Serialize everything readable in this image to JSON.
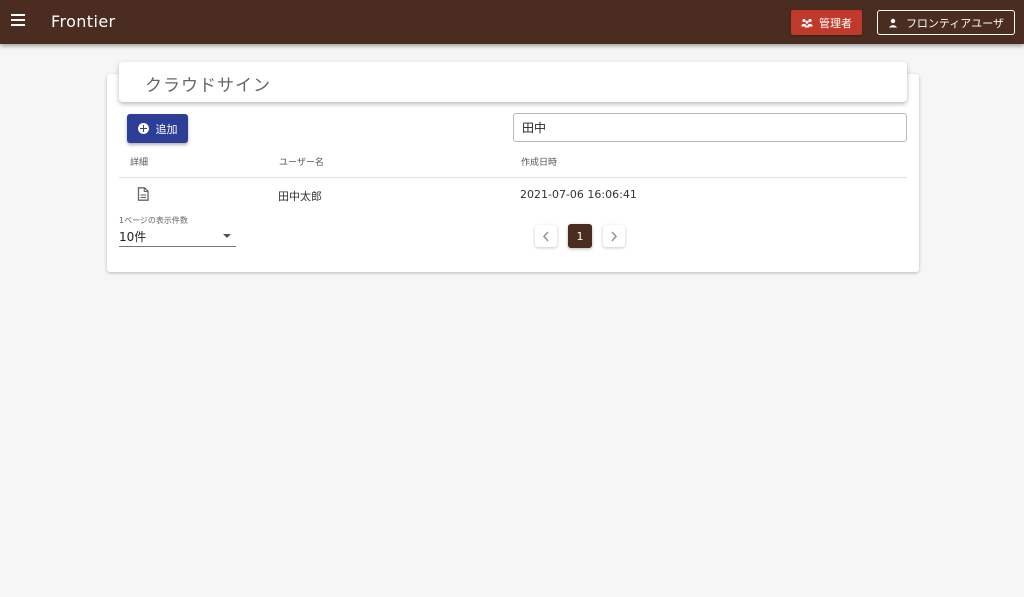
{
  "app": {
    "title": "Frontier"
  },
  "header": {
    "admin_label": "管理者",
    "user_label": "フロンティアユーザ"
  },
  "page": {
    "title": "クラウドサイン"
  },
  "toolbar": {
    "add_label": "追加"
  },
  "search": {
    "value": "田中"
  },
  "table": {
    "columns": [
      "詳細",
      "ユーザー名",
      "作成日時"
    ],
    "rows": [
      {
        "username": "田中太郎",
        "created_at": "2021-07-06 16:06:41"
      }
    ]
  },
  "pagination": {
    "per_page_label": "1ページの表示件数",
    "per_page_value": "10件",
    "current_page": "1"
  },
  "icons": {
    "menu": "menu-icon",
    "admin": "group-icon",
    "user": "person-icon",
    "add": "add-circle-icon",
    "detail": "document-icon",
    "prev": "chevron-left-icon",
    "next": "chevron-right-icon",
    "dropdown": "arrow-drop-down-icon"
  },
  "colors": {
    "appbar": "#4a2c20",
    "admin_button": "#c0392b",
    "add_button": "#2c3e96",
    "page_active": "#4a2c20"
  }
}
